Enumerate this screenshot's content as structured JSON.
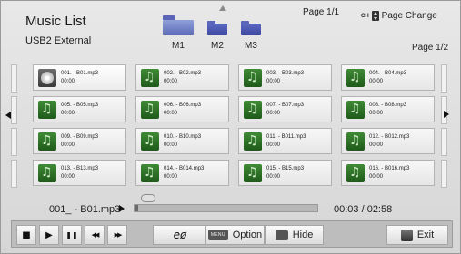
{
  "header": {
    "title": "Music List",
    "device": "USB2 External",
    "page_top": "Page 1/1",
    "page_change": {
      "ch": "CH",
      "label": "Page Change"
    },
    "page_right": "Page 1/2",
    "folders": [
      "M1",
      "M2",
      "M3"
    ]
  },
  "tracks": [
    {
      "name": "001. - B01.mp3",
      "time": "00:00",
      "icon": "disc-icon"
    },
    {
      "name": "002. - B02.mp3",
      "time": "00:00",
      "icon": "music-note-icon"
    },
    {
      "name": "003. - B03.mp3",
      "time": "00:00",
      "icon": "music-note-icon"
    },
    {
      "name": "004. - B04.mp3",
      "time": "00:00",
      "icon": "music-note-icon"
    },
    {
      "name": "005. - B05.mp3",
      "time": "00:00",
      "icon": "music-note-icon"
    },
    {
      "name": "006. - B06.mp3",
      "time": "00:00",
      "icon": "music-note-icon"
    },
    {
      "name": "007. - B07.mp3",
      "time": "00:00",
      "icon": "music-note-icon"
    },
    {
      "name": "008. - B08.mp3",
      "time": "00:00",
      "icon": "music-note-icon"
    },
    {
      "name": "009. - B09.mp3",
      "time": "00:00",
      "icon": "music-note-icon"
    },
    {
      "name": "010. - B10.mp3",
      "time": "00:00",
      "icon": "music-note-icon"
    },
    {
      "name": "011. - B011.mp3",
      "time": "00:00",
      "icon": "music-note-icon"
    },
    {
      "name": "012. - B012.mp3",
      "time": "00:00",
      "icon": "music-note-icon"
    },
    {
      "name": "013. - B13.mp3",
      "time": "00:00",
      "icon": "music-note-icon"
    },
    {
      "name": "014. - B014.mp3",
      "time": "00:00",
      "icon": "music-note-icon"
    },
    {
      "name": "015. - B15.mp3",
      "time": "00:00",
      "icon": "music-note-icon"
    },
    {
      "name": "016. - B016.mp3",
      "time": "00:00",
      "icon": "music-note-icon"
    }
  ],
  "player": {
    "now_playing": "001_ - B01.mp3",
    "elapsed_total": "00:03 / 02:58",
    "progress_fraction": 0.02
  },
  "controls": {
    "stop": "■",
    "play": "▶",
    "pause": "❚❚",
    "rewind": "◀◀",
    "forward": "▶▶",
    "repeat_symbol": "eø",
    "option_key": "MENU",
    "option_label": "Option",
    "hide_label": "Hide",
    "exit_label": "Exit"
  },
  "colors": {
    "folder": "#4a55b0",
    "track_icon": "#2f7a2a"
  }
}
